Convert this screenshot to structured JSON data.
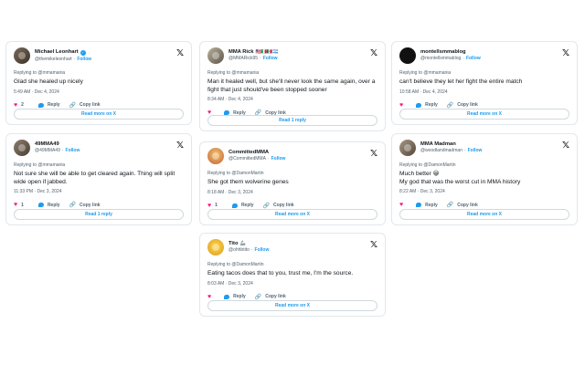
{
  "tweets": [
    {
      "name": "Michael Leonhart",
      "name_emoji": "",
      "handle": "@themikeleonhart",
      "follow": "Follow",
      "replying": "Replying to @mmamania",
      "text": "Glad she healed up nicely",
      "time": "5:49 AM · Dec 4, 2024",
      "likes": "2",
      "reply": "Reply",
      "copy": "Copy link",
      "bottom": "Read more on X"
    },
    {
      "name": "MMA Rick",
      "name_emoji": "🇺🇸🇮🇹🇲🇽🇦🇷",
      "handle": "@MMARick95",
      "follow": "Follow",
      "replying": "Replying to @mmamania",
      "text": "Man it healed well, but she'll never look the same again, over a fight that just should've been stopped sooner",
      "time": "8:34 AM · Dec 4, 2024",
      "likes": "",
      "reply": "Reply",
      "copy": "Copy link",
      "bottom": "Read 1 reply"
    },
    {
      "name": "montellsmmablog",
      "name_emoji": "",
      "handle": "@montellsmmablog",
      "follow": "Follow",
      "replying": "Replying to @mmamania",
      "text": "can't believe they let her fight the entire match",
      "time": "10:58 AM · Dec 4, 2024",
      "likes": "",
      "reply": "Reply",
      "copy": "Copy link",
      "bottom": "Read more on X"
    },
    {
      "name": "49MMA49",
      "name_emoji": "",
      "handle": "@49MMA49",
      "follow": "Follow",
      "replying": "Replying to @mmamania",
      "text": "Not sure she will be able to get cleared again. Thing will split wide open if jabbed.",
      "time": "11:33 PM · Dec 3, 2024",
      "likes": "1",
      "reply": "Reply",
      "copy": "Copy link",
      "bottom": "Read 1 reply"
    },
    {
      "name": "CommittedMMA",
      "name_emoji": "",
      "handle": "@CommittedMMA",
      "follow": "Follow",
      "replying": "Replying to @DamonMartin",
      "text": "She got them wolverine genes",
      "time": "8:18 AM · Dec 3, 2024",
      "likes": "1",
      "reply": "Reply",
      "copy": "Copy link",
      "bottom": "Read more on X"
    },
    {
      "name": "MMA Madman",
      "name_emoji": "",
      "handle": "@woodlandmadman",
      "follow": "Follow",
      "replying": "Replying to @DamonMartin",
      "text": "Much better 😀\nMy god that was the worst cut in MMA history",
      "time": "8:22 AM · Dec 3, 2024",
      "likes": "",
      "reply": "Reply",
      "copy": "Copy link",
      "bottom": "Read more on X"
    },
    {
      "name": "Tito",
      "name_emoji": "🦾",
      "handle": "@ohhbtito",
      "follow": "Follow",
      "replying": "Replying to @DamonMartin",
      "text": "Eating tacos does that to you, trust me, I'm the source.",
      "time": "8:03 AM · Dec 3, 2024",
      "likes": "",
      "reply": "Reply",
      "copy": "Copy link",
      "bottom": "Read more on X"
    }
  ],
  "icons": {
    "x_logo": "x-logo-icon",
    "heart": "heart-icon",
    "reply": "reply-bubble-icon",
    "link": "link-icon",
    "verified": "verified-badge-icon"
  },
  "colors": {
    "accent": "#1d9bf0",
    "like": "#f91880",
    "muted": "#536471",
    "border": "#e1e8ed"
  }
}
